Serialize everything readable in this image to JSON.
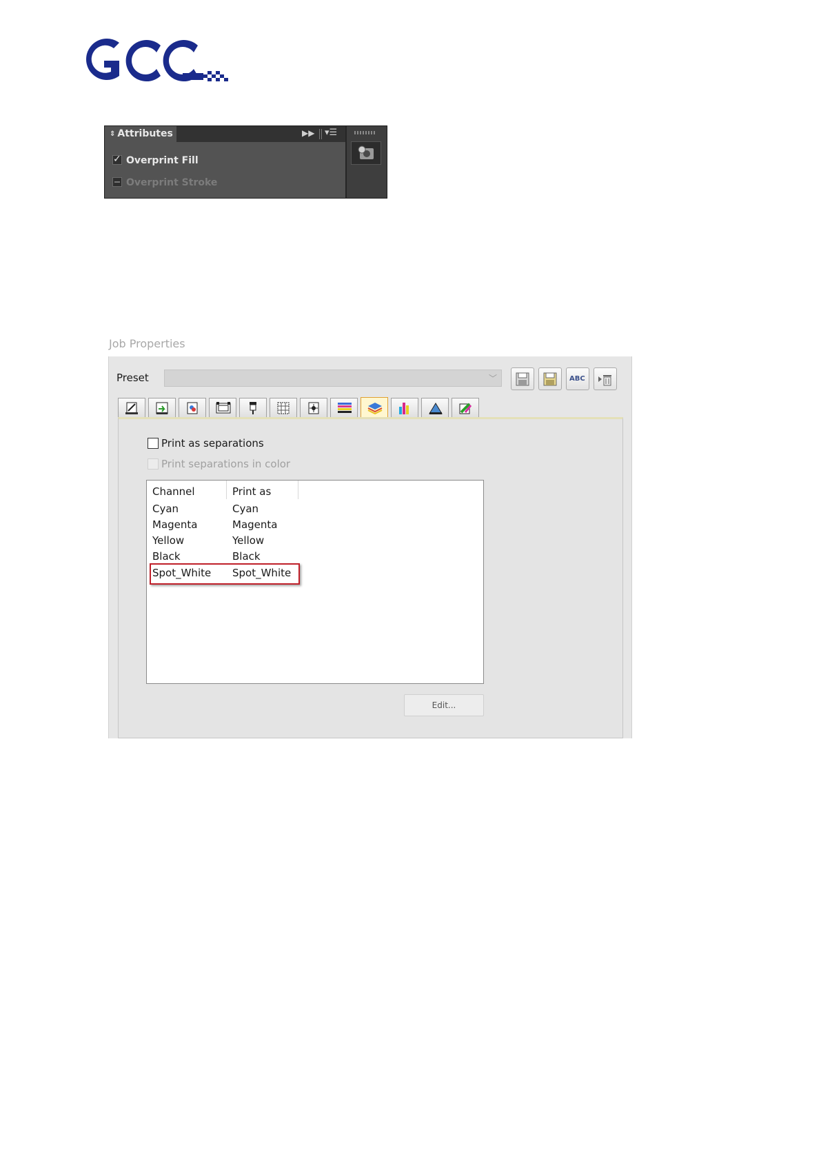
{
  "logo": {
    "text": "GCC"
  },
  "attributes_panel": {
    "tab_title": "Attributes",
    "options": [
      {
        "label": "Overprint Fill",
        "checked": true,
        "enabled": true
      },
      {
        "label": "Overprint Stroke",
        "checked": false,
        "enabled": false
      }
    ]
  },
  "job_properties": {
    "title": "Job Properties",
    "preset": {
      "label": "Preset",
      "value": ""
    },
    "preset_buttons": [
      {
        "icon": "save-icon"
      },
      {
        "icon": "save-as-icon"
      },
      {
        "icon": "rename-icon",
        "text": "ABC"
      },
      {
        "icon": "delete-icon"
      }
    ],
    "tab_icons": [
      "page-setup-icon",
      "layout-icon",
      "color-icon",
      "media-icon",
      "printer-icon",
      "grid-icon",
      "marks-icon",
      "layers-icon",
      "separations-icon",
      "ink-icon",
      "cut-icon",
      "color-picker-icon"
    ],
    "active_tab_index": 8,
    "print_as_separations": {
      "label": "Print as separations",
      "checked": false,
      "enabled": true
    },
    "print_separations_in_color": {
      "label": "Print separations in color",
      "checked": false,
      "enabled": false
    },
    "table": {
      "headers": [
        "Channel",
        "Print as"
      ],
      "rows": [
        [
          "Cyan",
          "Cyan"
        ],
        [
          "Magenta",
          "Magenta"
        ],
        [
          "Yellow",
          "Yellow"
        ],
        [
          "Black",
          "Black"
        ],
        [
          "Spot_White",
          "Spot_White"
        ]
      ],
      "highlighted_row_index": 4
    },
    "edit_button": "Edit..."
  },
  "colors": {
    "logo_blue": "#1a2b8c",
    "highlight_red": "#c0202a",
    "active_tab": "#e0a030"
  }
}
